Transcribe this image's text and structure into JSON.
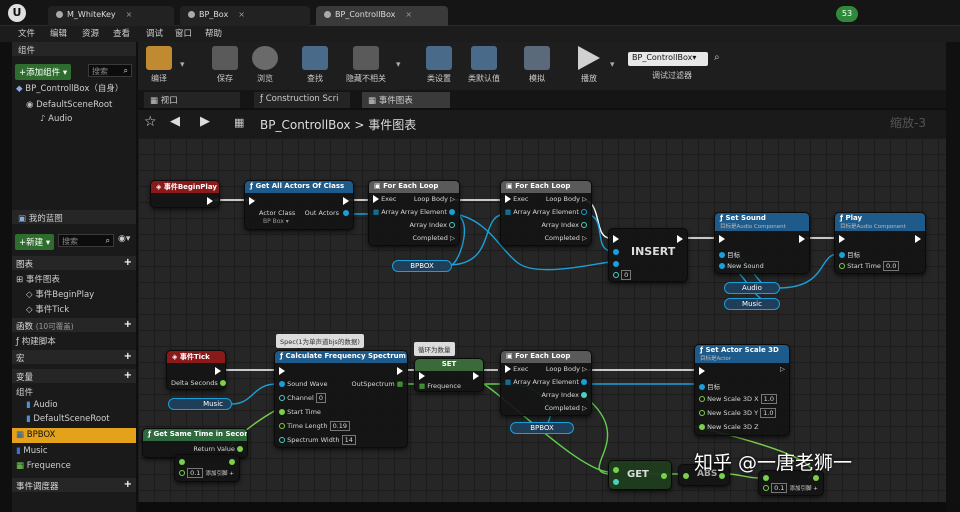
{
  "tabs": [
    {
      "label": "M_WhiteKey"
    },
    {
      "label": "BP_Box"
    },
    {
      "label": "BP_ControllBox"
    }
  ],
  "user_badge": "53",
  "menu": [
    "文件",
    "编辑",
    "资源",
    "查看",
    "调试",
    "窗口",
    "帮助"
  ],
  "components": {
    "title": "组件",
    "add_button": "+添加组件 ▾",
    "search_placeholder": "搜索",
    "self_item": "BP_ControllBox（自身）",
    "tree": [
      "DefaultSceneRoot",
      "Audio"
    ]
  },
  "my_blueprint": {
    "title": "我的蓝图",
    "new_button": "+新建 ▾",
    "search_placeholder": "搜索",
    "graphs_label": "图表",
    "event_graph_label": "事件图表",
    "events": [
      "事件BeginPlay",
      "事件Tick"
    ],
    "functions_label": "函数",
    "functions_count": "(10可覆盖)",
    "construction": "构建脚本",
    "macros_label": "宏",
    "variables_label": "变量",
    "components_label": "组件",
    "variables": [
      "Audio",
      "DefaultSceneRoot",
      "BPBOX",
      "Music",
      "Frequence"
    ],
    "dispatchers_label": "事件调度器"
  },
  "toolbar": {
    "buttons": [
      "编译",
      "保存",
      "浏览",
      "查找",
      "隐藏不相关",
      "类设置",
      "类默认值",
      "模拟",
      "播放"
    ],
    "debug_select": "BP_ControllBox▾",
    "debug_label": "调试过滤器"
  },
  "subtabs": [
    "视口",
    "Construction Scri",
    "事件图表"
  ],
  "breadcrumb": {
    "root": "BP_ControllBox",
    "sep": ">",
    "current": "事件图表",
    "zoom": "缩放-3"
  },
  "nodes": {
    "begin_play": "事件BeginPlay",
    "get_all": "Get All Actors Of Class",
    "get_all_actor_class": "Actor Class",
    "get_all_actor_value": "BP Box ▾",
    "get_all_out": "Out Actors",
    "foreach1": "For Each Loop",
    "foreach2": "For Each Loop",
    "foreach3": "For Each Loop",
    "exec": "Exec",
    "array": "Array",
    "loop_body": "Loop Body",
    "array_element": "Array Element",
    "array_index": "Array Index",
    "completed": "Completed",
    "bpbox1": "BPBOX",
    "bpbox2": "BPBOX",
    "insert": "INSERT",
    "insert_index": "0",
    "set_sound": "Set Sound",
    "set_sound_sub": "目标是Audio Component",
    "target": "目标",
    "new_sound": "New Sound",
    "play": "Play",
    "play_sub": "目标是Audio Component",
    "start_time": "Start Time",
    "start_time_val": "0.0",
    "audio": "Audio",
    "music1": "Music",
    "music2": "Music",
    "event_tick": "事件Tick",
    "delta": "Delta Seconds",
    "comment1": "Spec(1为单声道bjs的数据)",
    "calc": "Calculate Frequency Spectrum",
    "sound_wave": "Sound Wave",
    "channel": "Channel",
    "channel_val": "0",
    "start_time2": "Start Time",
    "time_length": "Time Length",
    "time_length_val": "0.19",
    "spectrum_width": "Spectrum Width",
    "spectrum_width_val": "14",
    "out_spectrum": "OutSpectrum",
    "comment2": "循环为数量",
    "set": "SET",
    "frequence": "Frequence",
    "set_scale": "Set Actor Scale 3D",
    "set_scale_sub": "目标是Actor",
    "new_scale_x": "New Scale 3D X",
    "new_scale_y": "New Scale 3D Y",
    "new_scale_z": "New Scale 3D Z",
    "scale_x_val": "1.0",
    "scale_y_val": "1.0",
    "get_same": "Get Same Time in Seconds",
    "return_value": "Return Value",
    "add_pin": "添加引脚 +",
    "add_val": "0.1",
    "get": "GET",
    "abs": "ABS",
    "add_val2": "0.1"
  },
  "watermark": "知乎 @一唐老狮一"
}
